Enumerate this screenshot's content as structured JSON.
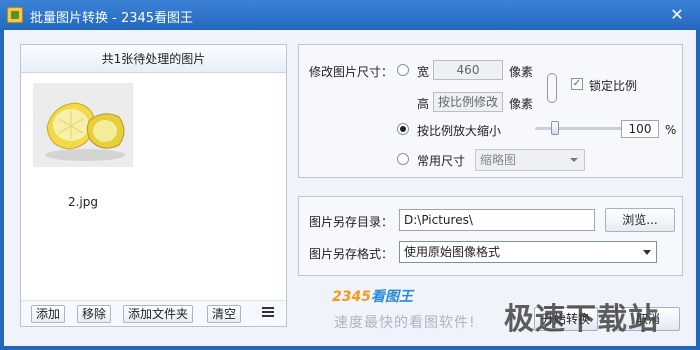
{
  "window": {
    "title": "批量图片转换 - 2345看图王",
    "close_glyph": "✕",
    "accent": "#2268bf"
  },
  "left_panel": {
    "header": "共1张待处理的图片",
    "thumbnail_caption": "2.jpg",
    "toolbar": {
      "add": "添加",
      "remove": "移除",
      "add_folder": "添加文件夹",
      "clear": "清空"
    }
  },
  "resize": {
    "label": "修改图片尺寸：",
    "width_label": "宽",
    "width_value": "460",
    "width_unit": "像素",
    "height_label": "高",
    "height_value": "按比例修改",
    "height_unit": "像素",
    "lock_ratio_label": "锁定比例",
    "lock_ratio_checked": true,
    "scale_label": "按比例放大缩小",
    "scale_value": "100",
    "scale_unit": "%",
    "scale_checked": true,
    "common_size_label": "常用尺寸",
    "common_size_value": "缩略图"
  },
  "save": {
    "dir_label": "图片另存目录：",
    "dir_value": "D:\\Pictures\\",
    "browse": "浏览...",
    "format_label": "图片另存格式：",
    "format_value": "使用原始图像格式"
  },
  "footer": {
    "brand_prefix": "2345",
    "brand_suffix": "看图王",
    "slogan": "速度最快的看图软件!",
    "convert": "开始转换",
    "close": "取消",
    "watermark": "极速下载站"
  }
}
